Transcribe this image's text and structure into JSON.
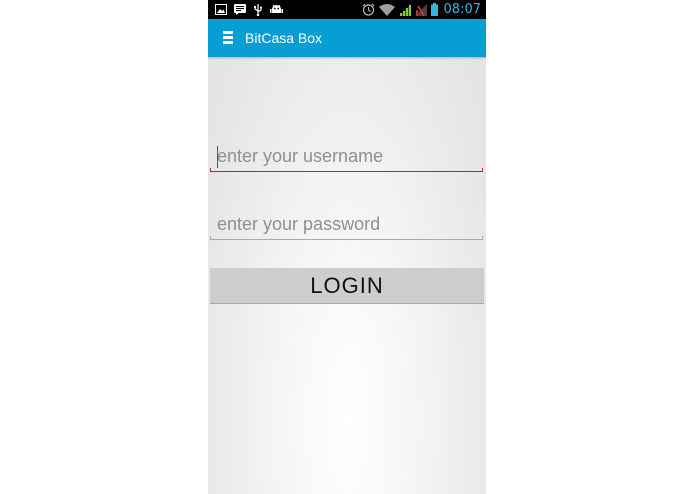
{
  "status_bar": {
    "time": "08:07",
    "left_icons": [
      "image-icon",
      "message-icon",
      "usb-icon",
      "android-icon"
    ],
    "right_icons": [
      "alarm-icon",
      "wifi-icon",
      "signal-icon",
      "signal-no-sim-icon",
      "battery-icon"
    ],
    "time_color": "#33b5e5"
  },
  "action_bar": {
    "title": "BitCasa Box",
    "color": "#079ed3",
    "menu_icon": "hamburger-menu-icon"
  },
  "form": {
    "username_placeholder": "enter your username",
    "username_value": "",
    "password_placeholder": "enter your password",
    "password_value": "",
    "login_label": "LOGIN",
    "focused_underline_color": "#c2185b"
  }
}
